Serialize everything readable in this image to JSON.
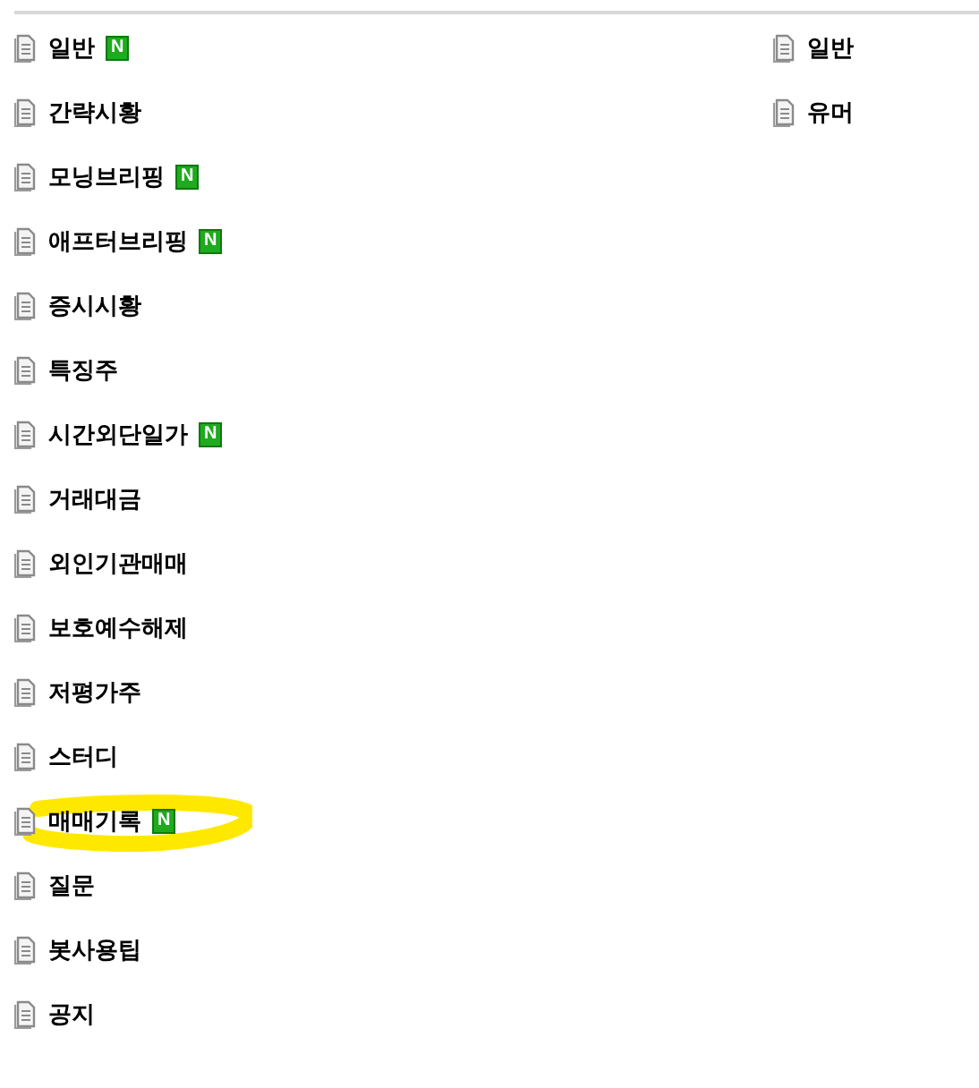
{
  "left_menu": [
    {
      "label": "일반",
      "new": true,
      "badge": "N",
      "highlighted": false
    },
    {
      "label": "간략시황",
      "new": false,
      "highlighted": false
    },
    {
      "label": "모닝브리핑",
      "new": true,
      "badge": "N",
      "highlighted": false
    },
    {
      "label": "애프터브리핑",
      "new": true,
      "badge": "N",
      "highlighted": false
    },
    {
      "label": "증시시황",
      "new": false,
      "highlighted": false
    },
    {
      "label": "특징주",
      "new": false,
      "highlighted": false
    },
    {
      "label": "시간외단일가",
      "new": true,
      "badge": "N",
      "highlighted": false
    },
    {
      "label": "거래대금",
      "new": false,
      "highlighted": false
    },
    {
      "label": "외인기관매매",
      "new": false,
      "highlighted": false
    },
    {
      "label": "보호예수해제",
      "new": false,
      "highlighted": false
    },
    {
      "label": "저평가주",
      "new": false,
      "highlighted": false
    },
    {
      "label": "스터디",
      "new": false,
      "highlighted": false
    },
    {
      "label": "매매기록",
      "new": true,
      "badge": "N",
      "highlighted": true
    },
    {
      "label": "질문",
      "new": false,
      "highlighted": false
    },
    {
      "label": "봇사용팁",
      "new": false,
      "highlighted": false
    },
    {
      "label": "공지",
      "new": false,
      "highlighted": false
    }
  ],
  "right_menu": [
    {
      "label": "일반",
      "new": false,
      "highlighted": false
    },
    {
      "label": "유머",
      "new": false,
      "highlighted": false
    }
  ]
}
